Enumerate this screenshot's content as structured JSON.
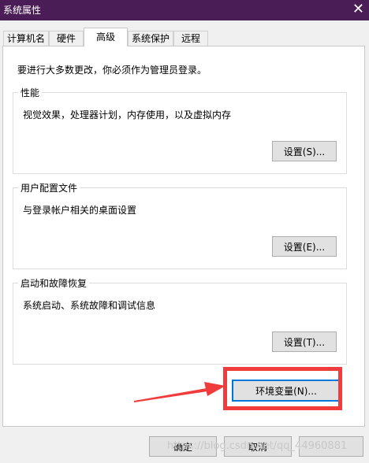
{
  "window": {
    "title": "系统属性",
    "close_glyph": "✕"
  },
  "tabs": [
    {
      "label": "计算机名",
      "active": false
    },
    {
      "label": "硬件",
      "active": false
    },
    {
      "label": "高级",
      "active": true
    },
    {
      "label": "系统保护",
      "active": false
    },
    {
      "label": "远程",
      "active": false
    }
  ],
  "admin_note": "要进行大多数更改，你必须作为管理员登录。",
  "groups": {
    "performance": {
      "label": "性能",
      "description": "视觉效果，处理器计划，内存使用，以及虚拟内存",
      "button": "设置(S)..."
    },
    "user_profiles": {
      "label": "用户配置文件",
      "description": "与登录帐户相关的桌面设置",
      "button": "设置(E)..."
    },
    "startup_recovery": {
      "label": "启动和故障恢复",
      "description": "系统启动、系统故障和调试信息",
      "button": "设置(T)..."
    }
  },
  "env_button": "环境变量(N)...",
  "bottom_buttons": {
    "ok": "确定",
    "cancel": "取消"
  },
  "watermark": "https://blog.csdn.net/qq_44960881",
  "colors": {
    "titlebar": "#4b1d56",
    "highlight": "#f03c3c",
    "focus": "#0078d7"
  }
}
